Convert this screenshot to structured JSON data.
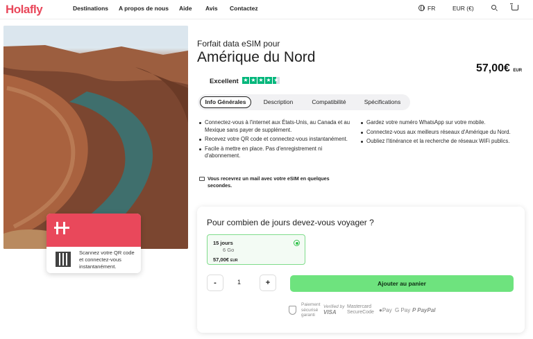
{
  "header": {
    "logo": "Holafly",
    "nav": [
      "Destinations",
      "A propos de nous",
      "Aide",
      "Avis",
      "Contactez"
    ],
    "language": "FR",
    "currency": "EUR (€)",
    "icons": [
      "globe-icon",
      "search-icon",
      "cart-icon"
    ]
  },
  "qr_card": {
    "text": "Scannez votre QR code et connectez-vous instantanément."
  },
  "product": {
    "subtitle": "Forfait data eSIM pour",
    "title": "Amérique du Nord",
    "price": "57,00€",
    "price_currency": "EUR",
    "rating_label": "Excellent",
    "rating_stars": 4.5
  },
  "tabs": [
    "Info Générales",
    "Description",
    "Compatibilité",
    "Spécifications"
  ],
  "bullets_left": [
    "Connectez-vous à l'internet aux États-Unis, au Canada et au Mexique sans payer de supplément.",
    "Recevez votre QR code et connectez-vous instantanément.",
    "Facile à mettre en place. Pas d'enregistrement ni d'abonnement."
  ],
  "bullets_right": [
    "Gardez votre numéro WhatsApp sur votre mobile.",
    "Connectez-vous aux meilleurs réseaux d'Amérique du Nord.",
    "Oubliez l'itinérance et la recherche de réseaux WiFi publics."
  ],
  "mail_note": "Vous recevrez un mail avec votre eSIM en quelques secondes.",
  "booking": {
    "question": "Pour combien de jours devez-vous voyager ?",
    "option_days": "15 jours",
    "option_data": "6 Go",
    "option_price": "57,00€",
    "option_currency": "EUR",
    "minus": "-",
    "quantity": "1",
    "plus": "+",
    "add_to_cart": "Ajouter au panier",
    "payment": {
      "secure_l1": "Paiement",
      "secure_l2": "sécurisé",
      "secure_l3": "garanti",
      "verified_l1": "Verified by",
      "verified_l2": "VISA",
      "mastercard_l1": "Mastercard",
      "mastercard_l2": "SecureCode",
      "apple_pay": "Pay",
      "google_pay": "G Pay",
      "paypal": "PayPal"
    }
  },
  "colors": {
    "brand": "#e9485b",
    "cta": "#6ee37e",
    "trustpilot": "#00b67a"
  }
}
